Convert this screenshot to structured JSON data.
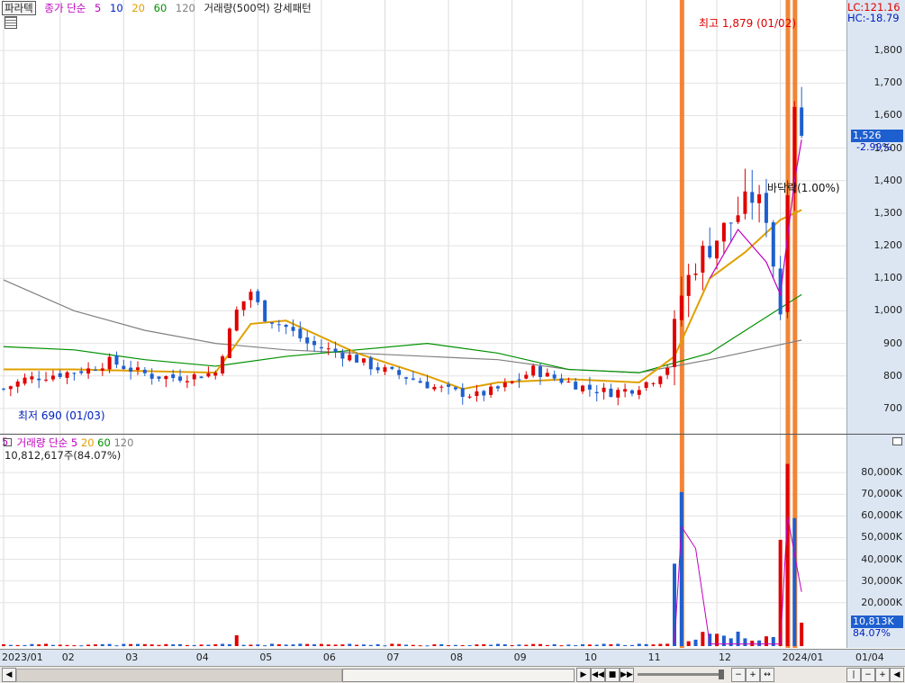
{
  "header": {
    "stock_name": "파라텍",
    "price_ma_title": "종가 단순",
    "ma_periods": [
      "5",
      "10",
      "20",
      "60",
      "120"
    ],
    "ma_colors": [
      "#c000c0",
      "#0020c0",
      "#e0a000",
      "#009000",
      "#808080"
    ],
    "volume_overlay": "거래량(500억) 강세패턴"
  },
  "right_badges": {
    "lc": "LC:121.16",
    "hc": "HC:-18.79"
  },
  "price_axis": {
    "ticks": [
      "1,800",
      "1,700",
      "1,600",
      "1,500",
      "1,400",
      "1,300",
      "1,200",
      "1,100",
      "1,000",
      "900",
      "800",
      "700"
    ],
    "current_price": "1,526",
    "current_change": "-2.99%"
  },
  "annotations": {
    "high": "최고 1,879 (01/02)",
    "low": "최저 690 (01/03)",
    "pattern": "바닥락(1.00%)"
  },
  "volume_panel": {
    "title": "거래량",
    "ma_title": "단순",
    "ma_periods": [
      "5",
      "20",
      "60",
      "120"
    ],
    "ma_colors": [
      "#c000c0",
      "#e0a000",
      "#009000",
      "#808080"
    ],
    "summary": "10,812,617주(84.07%)",
    "ticks": [
      "80,000K",
      "70,000K",
      "60,000K",
      "50,000K",
      "40,000K",
      "30,000K",
      "20,000K"
    ],
    "current_volume": "10,813K",
    "current_ratio": "84.07%"
  },
  "date_axis": {
    "labels": [
      "2023/01",
      "02",
      "03",
      "04",
      "05",
      "06",
      "07",
      "08",
      "09",
      "10",
      "11",
      "12",
      "2024/01",
      "01/04"
    ]
  },
  "chart_data": {
    "type": "candlestick",
    "price_ylim": [
      650,
      1900
    ],
    "volume_ylim_k": [
      0,
      90000
    ],
    "x_months": [
      "2023/01",
      "02",
      "03",
      "04",
      "05",
      "06",
      "07",
      "08",
      "09",
      "10",
      "11",
      "12",
      "2024/01"
    ],
    "close_path": [
      [
        0,
        760
      ],
      [
        3,
        790
      ],
      [
        6,
        800
      ],
      [
        9,
        810
      ],
      [
        12,
        820
      ],
      [
        15,
        845
      ],
      [
        18,
        820
      ],
      [
        21,
        800
      ],
      [
        24,
        795
      ],
      [
        27,
        800
      ],
      [
        30,
        810
      ],
      [
        33,
        1000
      ],
      [
        35,
        1060
      ],
      [
        37,
        980
      ],
      [
        40,
        950
      ],
      [
        43,
        900
      ],
      [
        46,
        880
      ],
      [
        49,
        860
      ],
      [
        52,
        830
      ],
      [
        55,
        810
      ],
      [
        58,
        790
      ],
      [
        61,
        765
      ],
      [
        64,
        750
      ],
      [
        67,
        740
      ],
      [
        70,
        760
      ],
      [
        73,
        790
      ],
      [
        75,
        820
      ],
      [
        77,
        800
      ],
      [
        80,
        780
      ],
      [
        83,
        760
      ],
      [
        86,
        750
      ],
      [
        89,
        760
      ],
      [
        92,
        790
      ],
      [
        94,
        830
      ],
      [
        96,
        1050
      ],
      [
        98,
        1150
      ],
      [
        100,
        1200
      ],
      [
        102,
        1250
      ],
      [
        104,
        1300
      ],
      [
        106,
        1350
      ],
      [
        108,
        1300
      ],
      [
        109,
        1150
      ],
      [
        110,
        1000
      ],
      [
        111,
        1400
      ],
      [
        112,
        1650
      ],
      [
        113,
        1526
      ]
    ],
    "ma_lines": {
      "ma120": [
        [
          0,
          1095
        ],
        [
          10,
          1000
        ],
        [
          20,
          940
        ],
        [
          30,
          900
        ],
        [
          40,
          880
        ],
        [
          50,
          870
        ],
        [
          60,
          860
        ],
        [
          70,
          850
        ],
        [
          80,
          820
        ],
        [
          90,
          810
        ],
        [
          100,
          850
        ],
        [
          113,
          910
        ]
      ],
      "ma60": [
        [
          0,
          890
        ],
        [
          10,
          880
        ],
        [
          20,
          850
        ],
        [
          30,
          830
        ],
        [
          40,
          860
        ],
        [
          50,
          880
        ],
        [
          60,
          900
        ],
        [
          70,
          870
        ],
        [
          80,
          820
        ],
        [
          90,
          810
        ],
        [
          100,
          870
        ],
        [
          113,
          1050
        ]
      ],
      "ma20": [
        [
          0,
          820
        ],
        [
          10,
          820
        ],
        [
          20,
          815
        ],
        [
          30,
          810
        ],
        [
          35,
          960
        ],
        [
          40,
          970
        ],
        [
          50,
          870
        ],
        [
          60,
          800
        ],
        [
          65,
          760
        ],
        [
          70,
          780
        ],
        [
          80,
          790
        ],
        [
          90,
          780
        ],
        [
          95,
          860
        ],
        [
          100,
          1100
        ],
        [
          105,
          1180
        ],
        [
          110,
          1280
        ],
        [
          113,
          1310
        ]
      ]
    },
    "volume_k_spikes": [
      [
        95,
        38000
      ],
      [
        96,
        71000
      ],
      [
        111,
        84000
      ],
      [
        112,
        59000
      ],
      [
        110,
        49000
      ],
      [
        113,
        10813
      ]
    ]
  }
}
